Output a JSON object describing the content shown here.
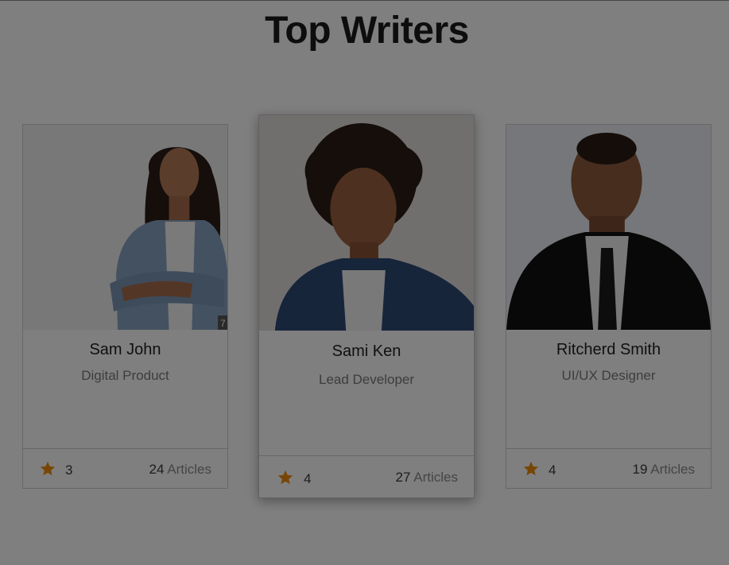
{
  "page": {
    "title": "Top Writers"
  },
  "writers": [
    {
      "name": "Sam John",
      "role": "Digital Product",
      "rating": "3",
      "articles_count": "24",
      "articles_label": "Articles",
      "photo_icon": "woman-portrait-photo",
      "photo_badge": "7"
    },
    {
      "name": "Sami Ken",
      "role": "Lead Developer",
      "rating": "4",
      "articles_count": "27",
      "articles_label": "Articles",
      "photo_icon": "man-curly-hair-portrait-photo"
    },
    {
      "name": "Ritcherd Smith",
      "role": "UI/UX Designer",
      "rating": "4",
      "articles_count": "19",
      "articles_label": "Articles",
      "photo_icon": "man-suit-portrait-photo"
    }
  ],
  "colors": {
    "star": "#ee8c0c",
    "overlay": "rgba(0,0,0,0.5)"
  }
}
